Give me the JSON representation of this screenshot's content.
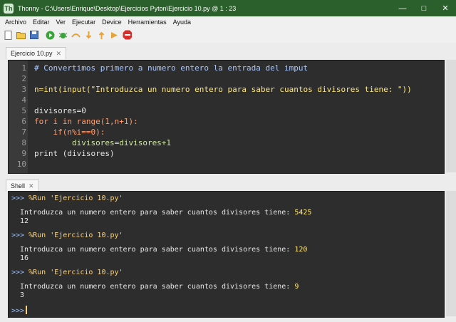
{
  "window": {
    "app_icon": "thonny-icon",
    "title": "Thonny  -  C:\\Users\\Enrique\\Desktop\\Ejercicios Pyton\\Ejercicio 10.py  @  1 : 23"
  },
  "menu": [
    "Archivo",
    "Editar",
    "Ver",
    "Ejecutar",
    "Device",
    "Herramientas",
    "Ayuda"
  ],
  "editor": {
    "tab_label": "Ejercicio 10.py",
    "line_numbers": [
      "1",
      "2",
      "3",
      "4",
      "5",
      "6",
      "7",
      "8",
      "9",
      "10"
    ],
    "lines": [
      "# Convertimos primero a numero entero la entrada del imput",
      "",
      "n=int(input(\"Introduzca un numero entero para saber cuantos divisores tiene: \"))",
      "",
      "divisores=0",
      "for i in range(1,n+1):",
      "    if(n%i==0):",
      "        divisores=divisores+1",
      "print (divisores)",
      ""
    ]
  },
  "shell": {
    "tab_label": "Shell",
    "prompt": ">>>",
    "runs": [
      {
        "command": "%Run 'Ejercicio 10.py'",
        "prompt_text": "Introduzca un numero entero para saber cuantos divisores tiene: ",
        "input": "5425",
        "output": "12"
      },
      {
        "command": "%Run 'Ejercicio 10.py'",
        "prompt_text": "Introduzca un numero entero para saber cuantos divisores tiene: ",
        "input": "120",
        "output": "16"
      },
      {
        "command": "%Run 'Ejercicio 10.py'",
        "prompt_text": "Introduzca un numero entero para saber cuantos divisores tiene: ",
        "input": "9",
        "output": "3"
      }
    ]
  },
  "colors": {
    "titlebar": "#2b5f2b",
    "editor_bg": "#2d2d2d",
    "comment": "#a9c7ff",
    "keyword": "#ff9c6e"
  }
}
